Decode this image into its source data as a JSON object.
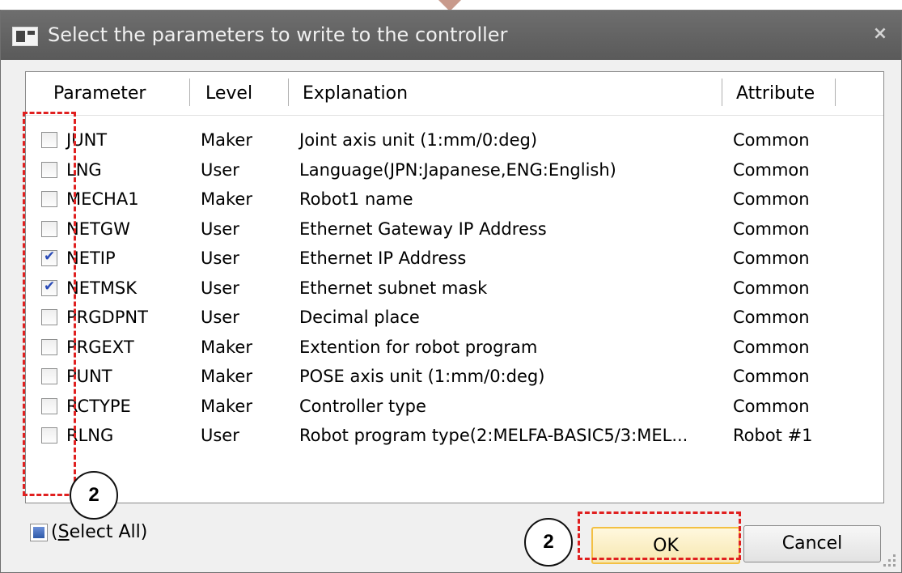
{
  "window": {
    "title": "Select the parameters to write to the controller",
    "close_glyph": "×"
  },
  "list": {
    "columns": [
      "Parameter",
      "Level",
      "Explanation",
      "Attribute"
    ],
    "rows": [
      {
        "parameter": "JUNT",
        "level": "Maker",
        "explanation": "Joint axis unit (1:mm/0:deg)",
        "attribute": "Common",
        "checked": false
      },
      {
        "parameter": "LNG",
        "level": "User",
        "explanation": "Language(JPN:Japanese,ENG:English)",
        "attribute": "Common",
        "checked": false
      },
      {
        "parameter": "MECHA1",
        "level": "Maker",
        "explanation": "Robot1 name",
        "attribute": "Common",
        "checked": false
      },
      {
        "parameter": "NETGW",
        "level": "User",
        "explanation": "Ethernet Gateway IP Address",
        "attribute": "Common",
        "checked": false
      },
      {
        "parameter": "NETIP",
        "level": "User",
        "explanation": "Ethernet IP Address",
        "attribute": "Common",
        "checked": true
      },
      {
        "parameter": "NETMSK",
        "level": "User",
        "explanation": "Ethernet subnet mask",
        "attribute": "Common",
        "checked": true
      },
      {
        "parameter": "PRGDPNT",
        "level": "User",
        "explanation": "Decimal place",
        "attribute": "Common",
        "checked": false
      },
      {
        "parameter": "PRGEXT",
        "level": "Maker",
        "explanation": "Extention for robot program",
        "attribute": "Common",
        "checked": false
      },
      {
        "parameter": "PUNT",
        "level": "Maker",
        "explanation": "POSE axis unit (1:mm/0:deg)",
        "attribute": "Common",
        "checked": false
      },
      {
        "parameter": "RCTYPE",
        "level": "Maker",
        "explanation": "Controller type",
        "attribute": "Common",
        "checked": false
      },
      {
        "parameter": "RLNG",
        "level": "User",
        "explanation": "Robot program type(2:MELFA-BASIC5/3:MEL...",
        "attribute": "Robot #1",
        "checked": false
      }
    ]
  },
  "select_all": {
    "prefix": "(",
    "mnemonic": "S",
    "rest": "elect All)"
  },
  "buttons": {
    "ok": "OK",
    "cancel": "Cancel"
  },
  "annotations": {
    "checkbox_callout": "2",
    "ok_callout": "2",
    "highlight_color": "#e02020"
  }
}
